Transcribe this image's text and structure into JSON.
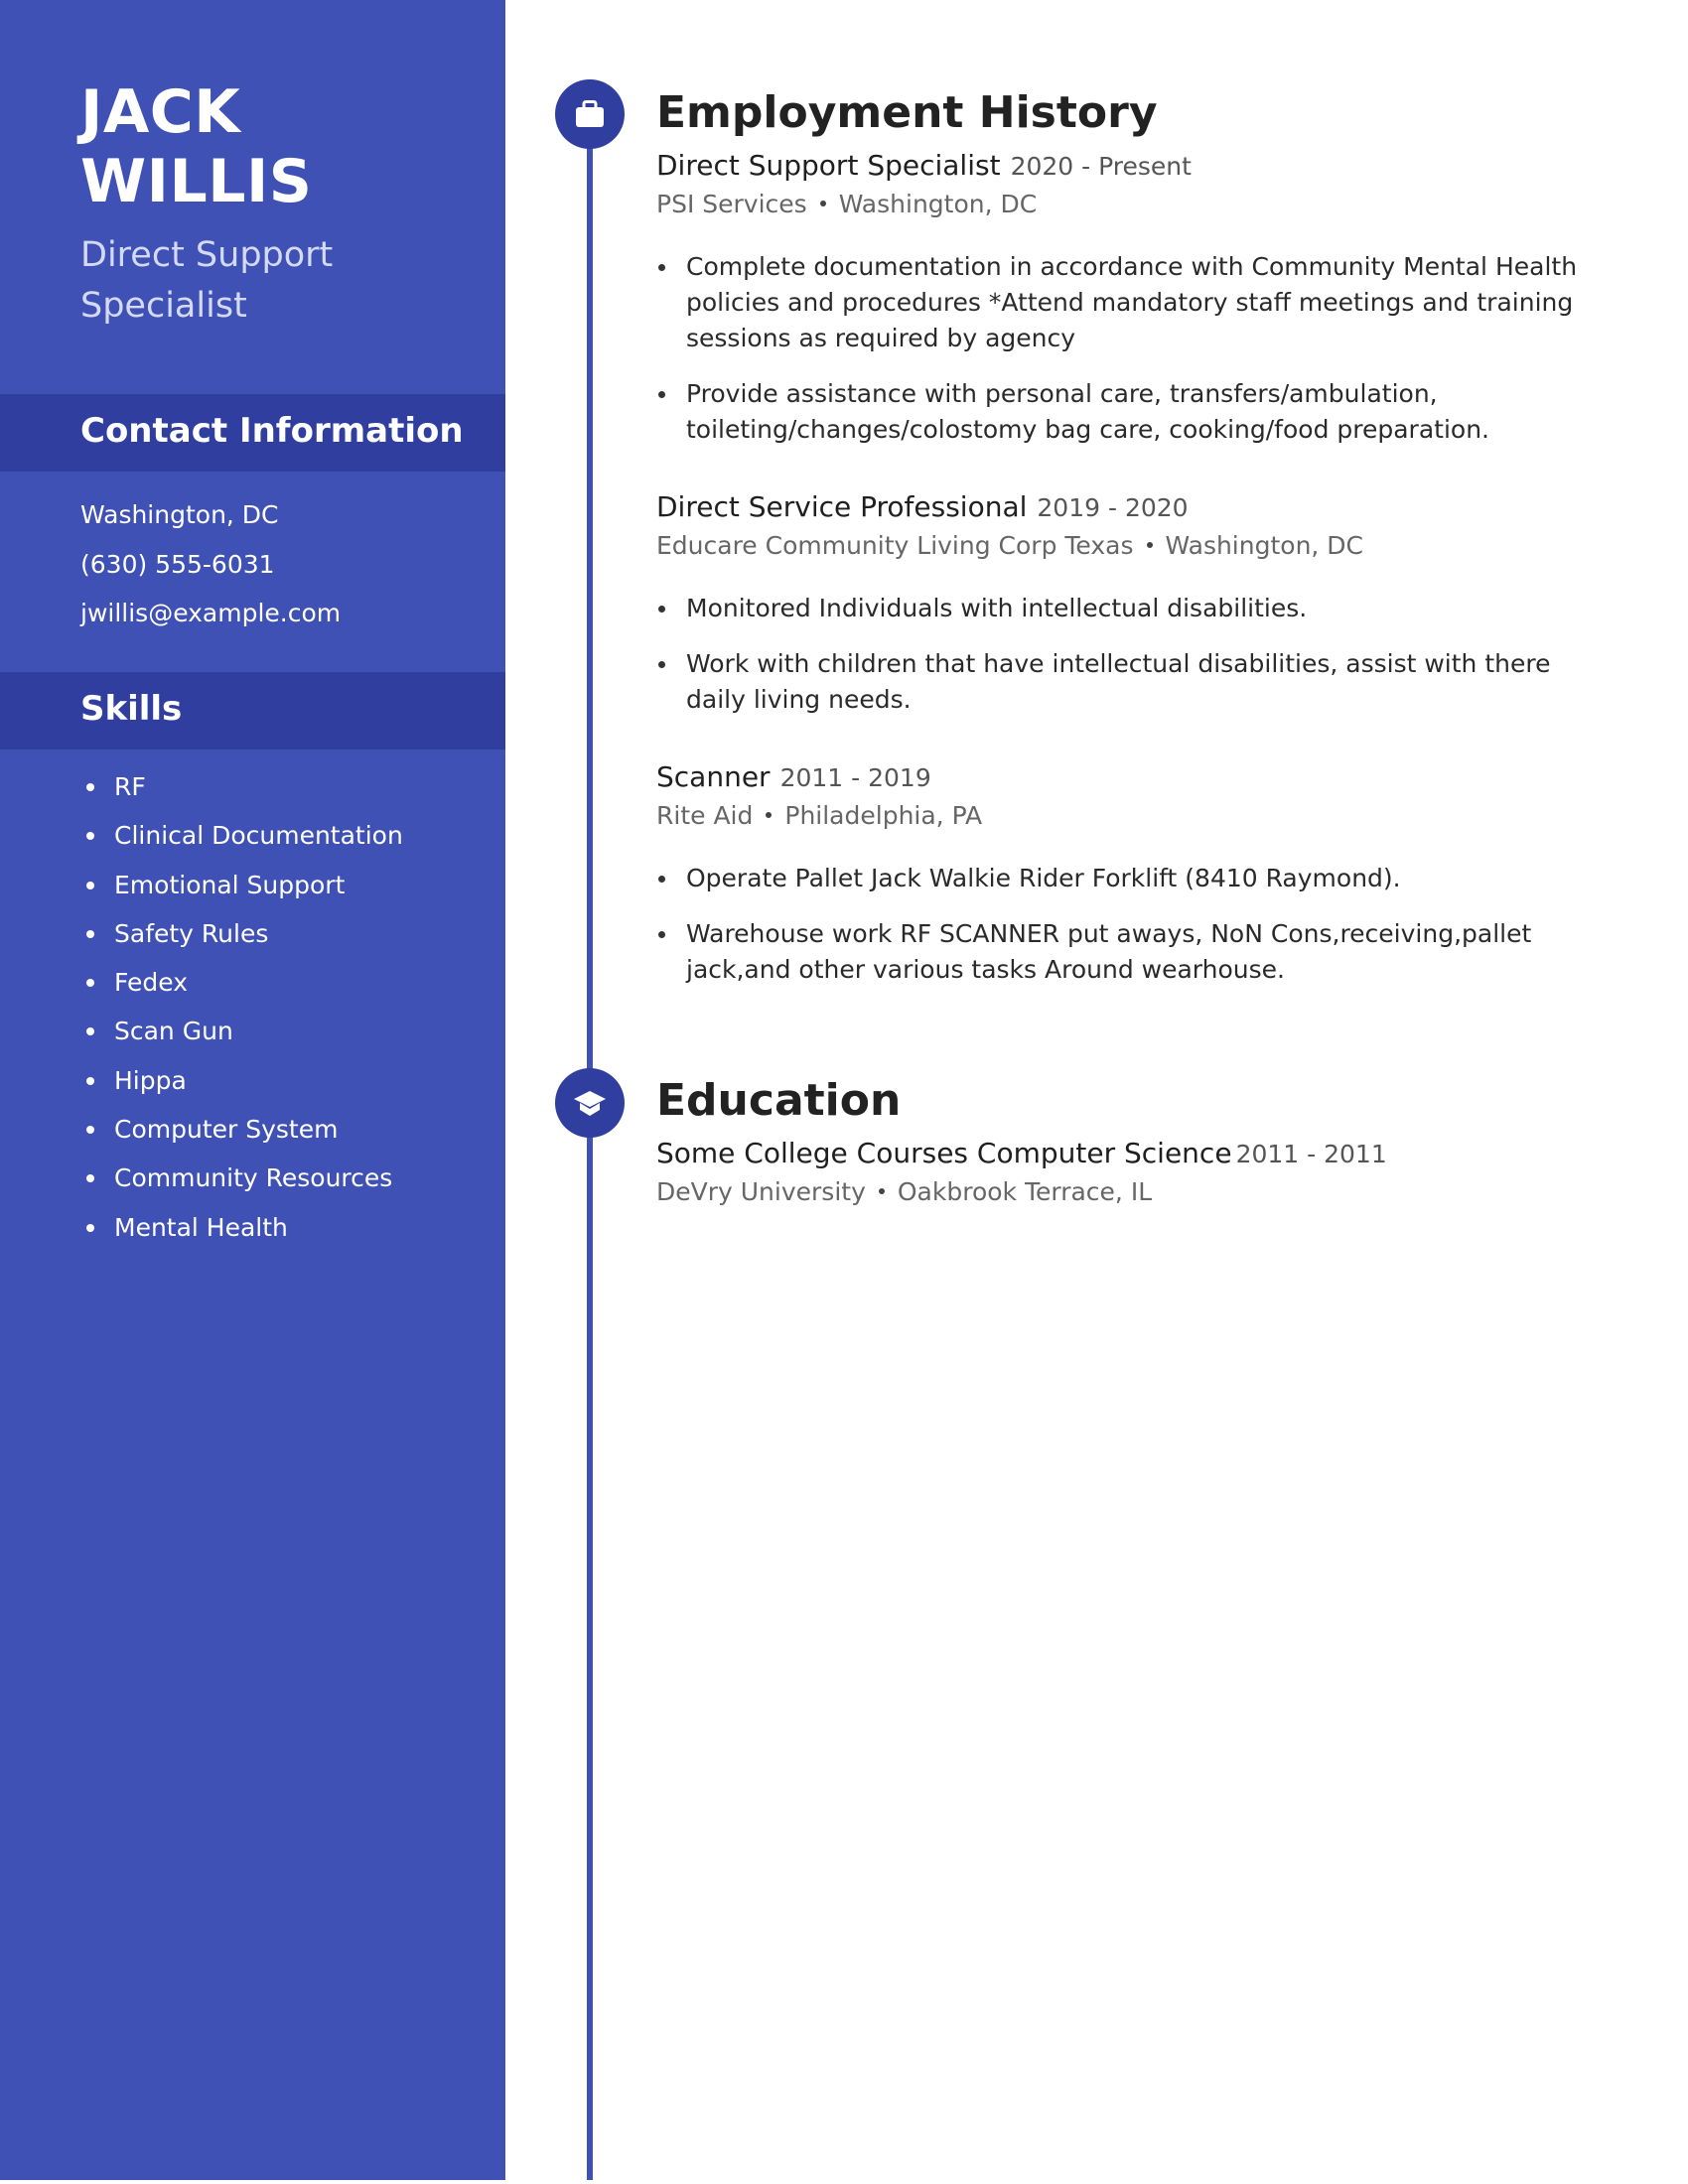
{
  "colors": {
    "sidebar": "#3f51b5",
    "sidebar_band": "#303f9f",
    "accent": "#3f51b5",
    "text": "#222222"
  },
  "profile": {
    "first_name": "JACK",
    "last_name": "WILLIS",
    "title": "Direct Support Specialist"
  },
  "contact": {
    "heading": "Contact Information",
    "items": [
      "Washington, DC",
      "(630) 555-6031",
      "jwillis@example.com"
    ]
  },
  "skills": {
    "heading": "Skills",
    "items": [
      "RF",
      "Clinical Documentation",
      "Emotional Support",
      "Safety Rules",
      "Fedex",
      "Scan Gun",
      "Hippa",
      "Computer System",
      "Community Resources",
      "Mental Health"
    ]
  },
  "employment": {
    "heading": "Employment History",
    "icon": "briefcase-icon",
    "jobs": [
      {
        "role": "Direct Support Specialist",
        "dates": "2020 - Present",
        "company": "PSI Services",
        "location": "Washington, DC",
        "bullets": [
          "Complete documentation in accordance with Community Mental Health policies and procedures *Attend mandatory staff meetings and training sessions as required by agency",
          "Provide assistance with personal care, transfers/ambulation, toileting/changes/colostomy bag care, cooking/food preparation."
        ]
      },
      {
        "role": "Direct Service Professional",
        "dates": "2019 - 2020",
        "company": "Educare Community Living Corp Texas",
        "location": "Washington, DC",
        "bullets": [
          "Monitored Individuals with intellectual disabilities.",
          "Work with children that have intellectual disabilities, assist with there daily living needs."
        ]
      },
      {
        "role": "Scanner",
        "dates": "2011 - 2019",
        "company": "Rite Aid",
        "location": "Philadelphia, PA",
        "bullets": [
          "Operate Pallet Jack Walkie Rider Forklift (8410 Raymond).",
          "Warehouse work RF SCANNER put aways, NoN Cons,receiving,pallet jack,and other various tasks Around wearhouse."
        ]
      }
    ]
  },
  "education": {
    "heading": "Education",
    "icon": "graduation-cap-icon",
    "items": [
      {
        "degree": "Some College Courses Computer Science",
        "dates": "2011 - 2011",
        "school": "DeVry University",
        "location": "Oakbrook Terrace, IL"
      }
    ]
  }
}
